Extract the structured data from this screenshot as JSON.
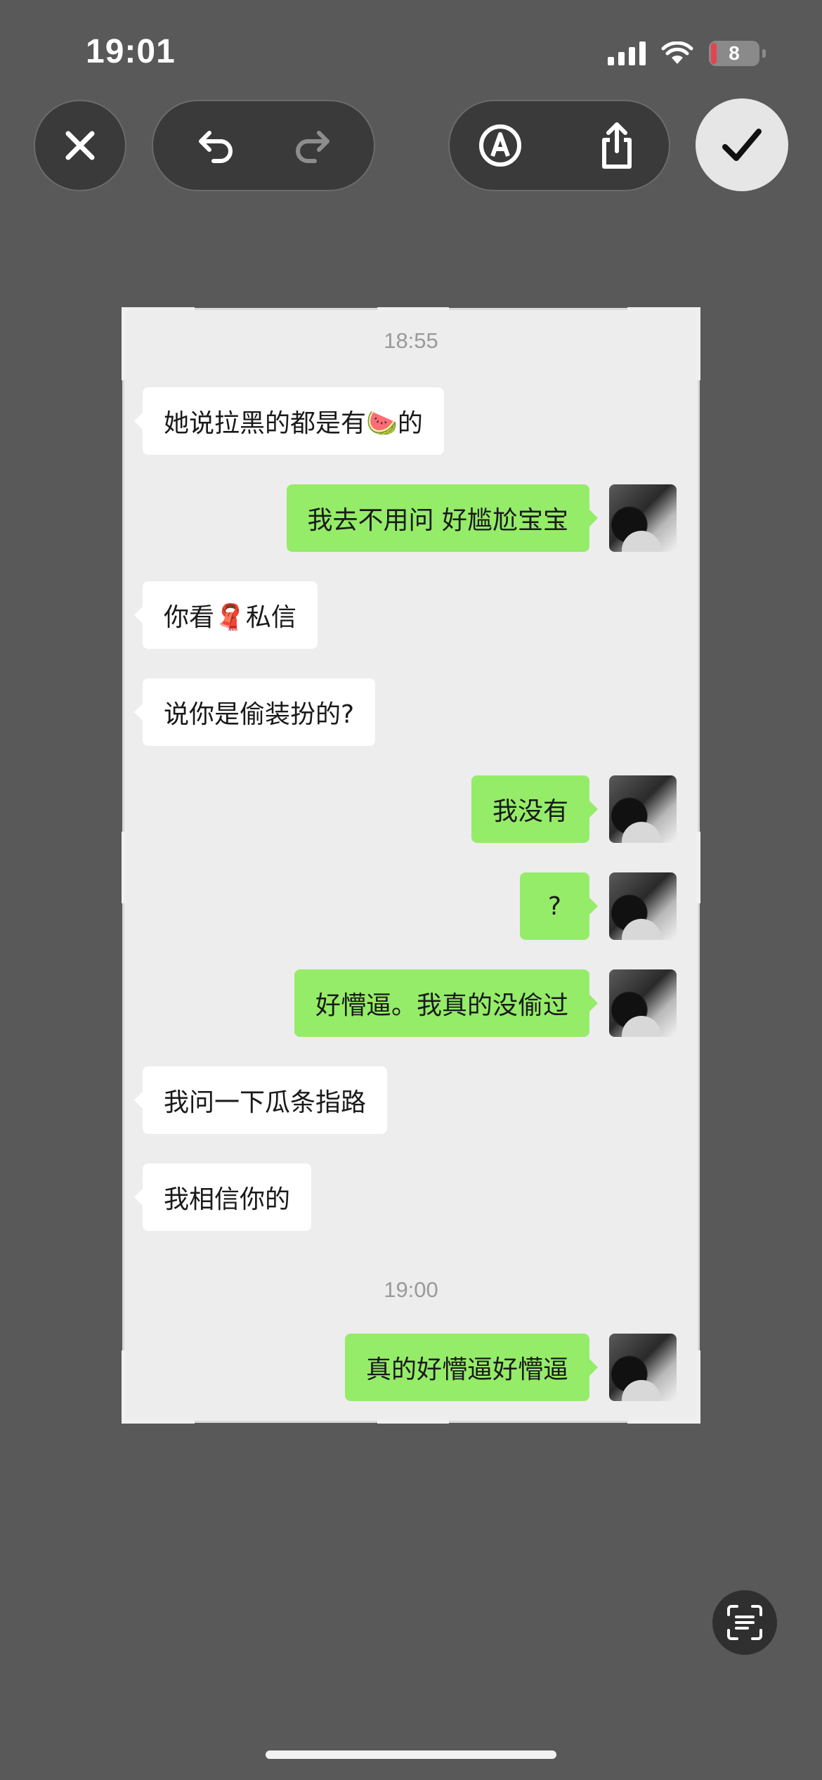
{
  "status_bar": {
    "time": "19:01",
    "battery": "8"
  },
  "toolbar": {
    "close_icon": "close-icon",
    "undo_icon": "undo-icon",
    "redo_icon": "redo-icon",
    "markup_icon": "markup-pen-icon",
    "share_icon": "share-icon",
    "done_icon": "checkmark-icon"
  },
  "chat": {
    "timestamp_1": "18:55",
    "timestamp_2": "19:00",
    "messages": [
      {
        "side": "left",
        "text": "她说拉黑的都是有🍉的"
      },
      {
        "side": "right",
        "text": "我去不用问 好尴尬宝宝"
      },
      {
        "side": "left",
        "text": "你看🧣私信"
      },
      {
        "side": "left",
        "text": "说你是偷装扮的?"
      },
      {
        "side": "right",
        "text": "我没有"
      },
      {
        "side": "right",
        "text": "?"
      },
      {
        "side": "right",
        "text": "好懵逼。我真的没偷过"
      },
      {
        "side": "left",
        "text": "我问一下瓜条指路"
      },
      {
        "side": "left",
        "text": "我相信你的"
      },
      {
        "side": "right",
        "text": "真的好懵逼好懵逼"
      }
    ]
  },
  "colors": {
    "background": "#595959",
    "chat_background": "#ededed",
    "incoming_bubble": "#ffffff",
    "outgoing_bubble": "#95ec69",
    "timestamp": "#9a9a9a"
  }
}
